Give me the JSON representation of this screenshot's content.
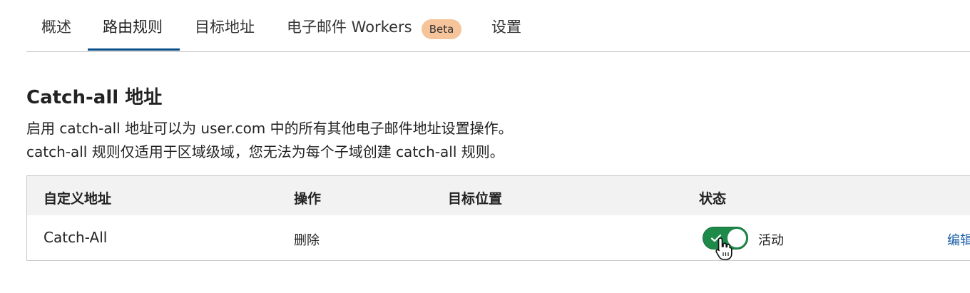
{
  "tabs": [
    {
      "label": "概述"
    },
    {
      "label": "路由规则",
      "active": true
    },
    {
      "label": "目标地址"
    },
    {
      "label": "电子邮件 Workers",
      "badge": "Beta"
    },
    {
      "label": "设置"
    }
  ],
  "section": {
    "title": "Catch-all 地址",
    "description_line1": "启用 catch-all 地址可以为 user.com 中的所有其他电子邮件地址设置操作。",
    "description_line2": "catch-all 规则仅适用于区域级域，您无法为每个子域创建 catch-all 规则。"
  },
  "table": {
    "headers": [
      "自定义地址",
      "操作",
      "目标位置",
      "状态"
    ],
    "rows": [
      {
        "address": "Catch-All",
        "action": "删除",
        "destination": "",
        "status": "活动",
        "enabled": true,
        "edit_label": "编辑"
      }
    ]
  },
  "colors": {
    "accent": "#0b4f8a",
    "toggle_on": "#1e8a4a",
    "badge_bg": "#f6c49b",
    "link": "#1a5fa8"
  },
  "icons": [
    "check-icon",
    "hand-pointer-cursor-icon"
  ]
}
